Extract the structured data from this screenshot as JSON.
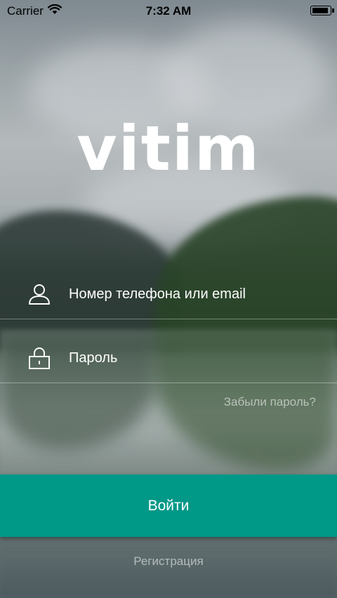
{
  "status_bar": {
    "carrier": "Carrier",
    "time": "7:32 AM",
    "icons": [
      "wifi-icon",
      "battery-icon"
    ]
  },
  "app": {
    "logo_text": "vitim"
  },
  "login_form": {
    "login_field": {
      "placeholder": "Номер телефона или email",
      "value": "",
      "icon": "user-icon"
    },
    "password_field": {
      "placeholder": "Пароль",
      "value": "",
      "icon": "lock-icon"
    },
    "forgot_password_label": "Забыли пароль?",
    "submit_label": "Войти",
    "register_label": "Регистрация"
  },
  "colors": {
    "accent": "#009887",
    "text": "#ffffff"
  }
}
